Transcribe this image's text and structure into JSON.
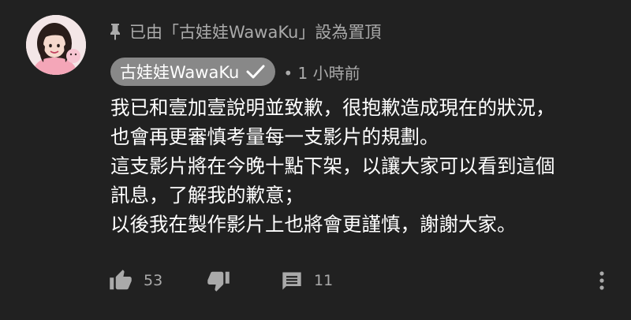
{
  "pinned": {
    "text": "已由「古娃娃WawaKu」設為置頂",
    "icon": "pin-icon"
  },
  "author": {
    "name": "古娃娃WawaKu",
    "verified_icon": "checkmark-icon",
    "chip_color": "#888888"
  },
  "timestamp": "• 1 小時前",
  "comment_lines": [
    "我已和壹加壹說明並致歉，很抱歉造成現在的狀況，",
    "也會再更審慎考量每一支影片的規劃。",
    "這支影片將在今晚十點下架，以讓大家可以看到這個",
    "訊息，了解我的歉意；",
    "以後我在製作影片上也將會更謹慎，謝謝大家。"
  ],
  "actions": {
    "like_icon": "thumb-up-icon",
    "like_count": "53",
    "dislike_icon": "thumb-down-icon",
    "reply_icon": "comment-icon",
    "reply_count": "11",
    "more_icon": "more-vert-icon"
  },
  "colors": {
    "background": "#212121",
    "text": "#ffffff",
    "secondary": "#aaaaaa"
  }
}
